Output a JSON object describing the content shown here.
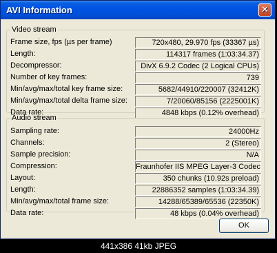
{
  "window": {
    "title": "AVI Information",
    "close_glyph": "✕",
    "ok_label": "OK"
  },
  "video": {
    "legend": "Video stream",
    "rows": [
      {
        "label": "Frame size, fps (µs per frame)",
        "value": "720x480, 29.970 fps (33367 µs)"
      },
      {
        "label": "Length:",
        "value": "114317 frames (1:03:34.37)"
      },
      {
        "label": "Decompressor:",
        "value": "DivX 6.9.2 Codec (2 Logical CPUs)"
      },
      {
        "label": "Number of key frames:",
        "value": "739"
      },
      {
        "label": "Min/avg/max/total key frame size:",
        "value": "5682/44910/220007 (32412K)"
      },
      {
        "label": "Min/avg/max/total delta frame size:",
        "value": "7/20060/85156 (2225001K)"
      },
      {
        "label": "Data rate:",
        "value": "4848 kbps (0.12% overhead)"
      }
    ]
  },
  "audio": {
    "legend": "Audio stream",
    "rows": [
      {
        "label": "Sampling rate:",
        "value": "24000Hz"
      },
      {
        "label": "Channels:",
        "value": "2 (Stereo)"
      },
      {
        "label": "Sample precision:",
        "value": "N/A"
      },
      {
        "label": "Compression:",
        "value": "Fraunhofer IIS MPEG Layer-3 Codec"
      },
      {
        "label": "Layout:",
        "value": "350 chunks (10.92s preload)"
      },
      {
        "label": "Length:",
        "value": "22886352 samples (1:03:34.39)"
      },
      {
        "label": "Min/avg/max/total frame size:",
        "value": "14288/65389/65536 (22350K)"
      },
      {
        "label": "Data rate:",
        "value": "48 kbps (0.04% overhead)"
      }
    ]
  },
  "caption": "441x386 41kb JPEG",
  "colors": {
    "titlebar": "#0054e3",
    "dialog_bg": "#ece9d8",
    "close_button": "#c3411c"
  }
}
